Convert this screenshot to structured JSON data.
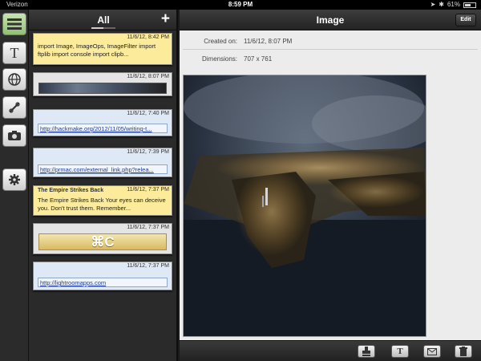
{
  "status_bar": {
    "carrier": "Verizon",
    "time": "8:59 PM",
    "battery": "61%",
    "battery_level": 0.61
  },
  "rail": {
    "items": [
      {
        "icon": "list-icon",
        "active": true
      },
      {
        "icon": "text-icon",
        "glyph": "T"
      },
      {
        "icon": "globe-icon"
      },
      {
        "icon": "link-icon"
      },
      {
        "icon": "camera-icon"
      },
      {
        "icon": "gear-icon"
      }
    ]
  },
  "list": {
    "title": "All",
    "add_label": "+",
    "items": [
      {
        "type": "text",
        "time": "11/6/12, 8:42 PM",
        "text": "import Image, ImageOps, ImageFilter import ftplib import console import clipb..."
      },
      {
        "type": "image",
        "time": "11/6/12, 8:07 PM"
      },
      {
        "type": "link",
        "time": "11/6/12, 7:40 PM",
        "url": "http://hackmake.org/2012/11/05/writing-t..."
      },
      {
        "type": "link",
        "time": "11/6/12, 7:39 PM",
        "url": "http://prmac.com/external_link.php?relea..."
      },
      {
        "type": "text",
        "time": "11/6/12, 7:37 PM",
        "title": "The Empire Strikes Back",
        "text": "The Empire Strikes Back Your eyes can deceive you. Don't trust them. Remember..."
      },
      {
        "type": "image",
        "time": "11/6/12, 7:37 PM",
        "glyph": "⌘C"
      },
      {
        "type": "link",
        "time": "11/6/12, 7:37 PM",
        "url": "http://lightroomapps.com"
      }
    ]
  },
  "detail": {
    "title": "Image",
    "edit_label": "Edit",
    "created_label": "Created on:",
    "created_value": "11/6/12, 8:07 PM",
    "dimensions_label": "Dimensions:",
    "dimensions_value": "707 x 761"
  },
  "toolbar": {
    "buttons": [
      {
        "icon": "stamp-icon"
      },
      {
        "icon": "text-icon",
        "glyph": "T"
      },
      {
        "icon": "mail-icon"
      },
      {
        "icon": "trash-icon"
      }
    ]
  },
  "colors": {
    "note_yellow": "#fbeb9b",
    "link_blue": "#1d3c9e",
    "active_green": "#a8d08a"
  }
}
